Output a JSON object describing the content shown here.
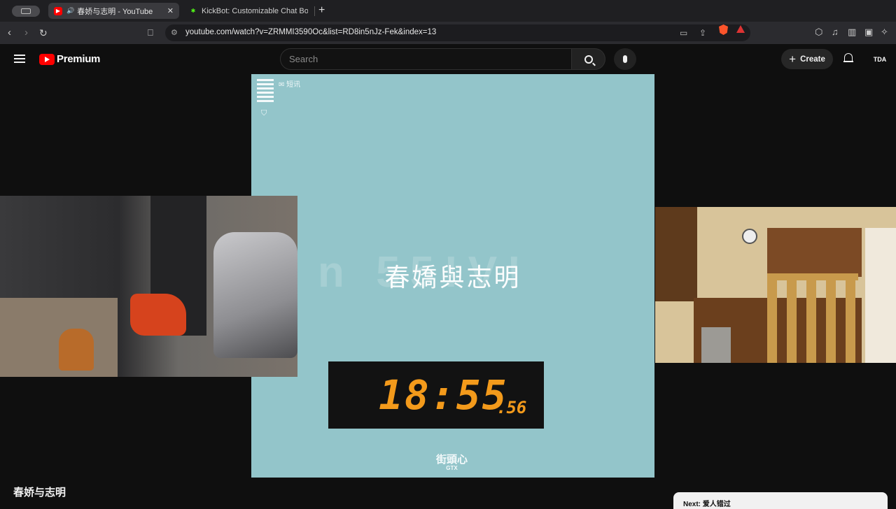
{
  "browser": {
    "tabs": [
      {
        "title": "春娇与志明 - YouTube",
        "active": true,
        "audio": true
      },
      {
        "title": "KickBot: Customizable Chat Bot fo",
        "active": false
      }
    ],
    "new_tab_label": "+",
    "url": "youtube.com/watch?v=ZRMMI3590Oc&list=RD8in5nJz-Fek&index=13",
    "icons": [
      "back-icon",
      "forward-icon",
      "reload-icon",
      "bookmark-icon",
      "site-settings-icon",
      "cast-icon",
      "share-icon",
      "brave-shields-icon",
      "brave-rewards-icon",
      "extensions-icon",
      "media-icon",
      "sidebar-icon",
      "wallet-icon",
      "leo-icon"
    ]
  },
  "youtube": {
    "brand": "Premium",
    "search_placeholder": "Search",
    "create_label": "Create",
    "avatar_text": "TDA"
  },
  "video": {
    "background_color": "#93c5ca",
    "overlay_mail_text": "短讯",
    "watermark_text": "n 55!V!",
    "song_title": "春嬌與志明",
    "clock_time": "18:55",
    "clock_centiseconds": ".56",
    "clock_color": "#f39a1b",
    "channel_logo_top": "街頭心",
    "channel_logo_bottom": "GTX"
  },
  "page": {
    "video_title": "春娇与志明",
    "next_label": "Next: 爱人错过"
  }
}
